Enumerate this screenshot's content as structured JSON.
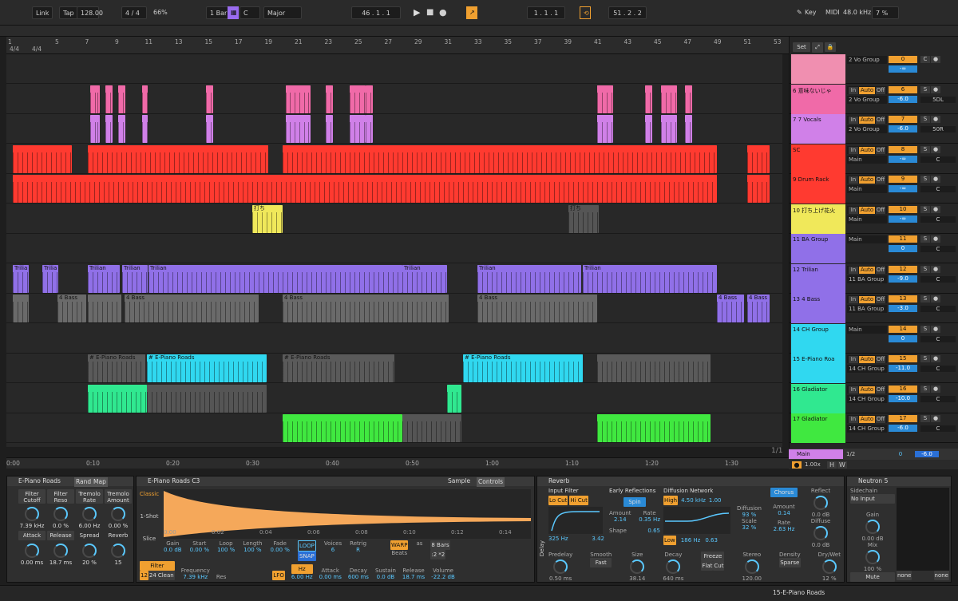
{
  "transport": {
    "link": "Link",
    "tap": "Tap",
    "tempo": "128.00",
    "sig_num": "4",
    "sig_den": "4",
    "groove": "66%",
    "quant": "1 Bar",
    "key": "C",
    "scale": "Major",
    "position": "46 . 1 . 1",
    "loop_start": "1 . 1 . 1",
    "loop_len": "51 . 2 . 2",
    "key_btn": "Key",
    "midi": "MIDI",
    "sample_rate": "48.0 kHz",
    "cpu": "7 %"
  },
  "ruler": {
    "bars": [
      "1",
      "5",
      "7",
      "9",
      "11",
      "13",
      "15",
      "17",
      "19",
      "21",
      "23",
      "25",
      "27",
      "29",
      "31",
      "33",
      "35",
      "37",
      "39",
      "41",
      "43",
      "45",
      "47",
      "49",
      "51",
      "53"
    ],
    "sig": "4/4",
    "sig2": "4/4"
  },
  "timeline": {
    "marks": [
      "0:00",
      "0:10",
      "0:20",
      "0:30",
      "0:40",
      "0:50",
      "1:00",
      "1:10",
      "1:20",
      "1:30"
    ]
  },
  "clips": {
    "trilian": "Trilian",
    "trilia": "Trilia",
    "bass": "4 Bass",
    "epiano": "# E-Piano Roads",
    "uchi": "打ち",
    "uchi2": "打ち"
  },
  "tracks": [
    {
      "name": "",
      "route": "2 Vo Group",
      "vol": "0",
      "pan": "C",
      "vol2": "-∞",
      "color": "#f08fb0"
    },
    {
      "name": "6 意味ないじゃ",
      "route": "2 Vo Group",
      "vol": "6",
      "pan": "S",
      "vol2": "-6.0",
      "pan2": "5DL",
      "color": "#f06aa8",
      "in": "In",
      "auto": "Auto",
      "off": "Off"
    },
    {
      "name": "7 7 Vocals",
      "route": "2 Vo Group",
      "vol": "7",
      "pan": "S",
      "vol2": "-6.0",
      "pan2": "50R",
      "color": "#d080e8",
      "in": "In",
      "auto": "Auto",
      "off": "Off"
    },
    {
      "name": "SC",
      "route": "Main",
      "vol": "8",
      "pan": "S",
      "vol2": "-∞",
      "pan2": "C",
      "color": "#ff3a30",
      "in": "In",
      "auto": "Auto",
      "off": "Off"
    },
    {
      "name": "9 Drum Rack",
      "route": "Main",
      "vol": "9",
      "pan": "S",
      "vol2": "-∞",
      "pan2": "C",
      "color": "#ff3a30",
      "in": "In",
      "auto": "Auto",
      "off": "Off"
    },
    {
      "name": "10 打ち上げ花火",
      "route": "Main",
      "vol": "10",
      "pan": "S",
      "vol2": "-∞",
      "pan2": "C",
      "color": "#f0e85a",
      "in": "In",
      "auto": "Auto",
      "off": "Off"
    },
    {
      "name": "11 BA Group",
      "route": "Main",
      "vol": "11",
      "pan": "S",
      "vol2": "0",
      "pan2": "C",
      "color": "#9070e8"
    },
    {
      "name": "12 Trilian",
      "route": "11 BA Group",
      "vol": "12",
      "pan": "S",
      "vol2": "-9.0",
      "pan2": "C",
      "color": "#9070e8",
      "in": "In",
      "auto": "Auto",
      "off": "Off"
    },
    {
      "name": "13 4 Bass",
      "route": "11 BA Group",
      "vol": "13",
      "pan": "S",
      "vol2": "-3.0",
      "pan2": "C",
      "color": "#9070e8",
      "in": "In",
      "auto": "Auto",
      "off": "Off"
    },
    {
      "name": "14 CH Group",
      "route": "Main",
      "vol": "14",
      "pan": "S",
      "vol2": "0",
      "pan2": "C",
      "color": "#30d8f0"
    },
    {
      "name": "15 E-Piano Roa",
      "route": "14 CH Group",
      "vol": "15",
      "pan": "S",
      "vol2": "-11.0",
      "pan2": "C",
      "color": "#30d8f0",
      "in": "In",
      "auto": "Auto",
      "off": "Off"
    },
    {
      "name": "16 Gladiator",
      "route": "14 CH Group",
      "vol": "16",
      "pan": "S",
      "vol2": "-10.0",
      "pan2": "C",
      "color": "#30e890",
      "in": "In",
      "auto": "Auto",
      "off": "Off"
    },
    {
      "name": "17 Gladiator",
      "route": "14 CH Group",
      "vol": "17",
      "pan": "S",
      "vol2": "-6.0",
      "pan2": "C",
      "color": "#40e840",
      "in": "In",
      "auto": "Auto",
      "off": "Off"
    }
  ],
  "main": {
    "name": "Main",
    "val": "1/2",
    "vol": "0",
    "pan": "-6.0",
    "zoom": "1.00x",
    "h": "H",
    "w": "W",
    "set": "Set",
    "page": "1/1"
  },
  "devices": {
    "rack": {
      "title": "E-Piano Roads",
      "rand": "Rand",
      "map": "Map",
      "k1": "Filter Cutoff",
      "k2": "Filter Reso",
      "k3": "Tremolo Rate",
      "k4": "Tremolo Amount",
      "v1": "7.39 kHz",
      "v2": "0.0 %",
      "v3": "6.00 Hz",
      "v4": "0.00 %",
      "k5": "Attack",
      "k6": "Release",
      "k7": "Spread",
      "k8": "Reverb",
      "v5": "0.00 ms",
      "v6": "18.7 ms",
      "v7": "20 %",
      "v8": "15"
    },
    "simpler": {
      "title": "E-Piano Roads C3",
      "sample": "Sample",
      "controls": "Controls",
      "classic": "Classic",
      "oneshot": "1-Shot",
      "slice": "Slice",
      "gain": "Gain",
      "gain_v": "0.0 dB",
      "start": "Start",
      "start_v": "0.00 %",
      "loop": "Loop",
      "loop_v": "100 %",
      "length": "Length",
      "length_v": "100 %",
      "fade": "Fade",
      "fade_v": "0.00 %",
      "loopbtn": "LOOP",
      "snap": "SNAP",
      "voices": "Voices",
      "voices_v": "6",
      "retrig": "Retrig",
      "retrig_v": "R",
      "warp": "WARP",
      "as": "as",
      "bars": "8 Bars",
      "beats": "Beats",
      "t0": "0:00",
      "t1": "0:02",
      "t2": "0:04",
      "t3": "0:06",
      "t4": "0:08",
      "t5": "0:10",
      "t6": "0:12",
      "t7": "0:14",
      "filter": "Filter",
      "freq": "Frequency",
      "freq_v": "7.39 kHz",
      "res": "Res",
      "f12": "12",
      "f24": "24",
      "clean": "Clean",
      "lfo": "LFO",
      "hz": "Hz",
      "lfo_v": "6.00 Hz",
      "attack": "Attack",
      "attack_v": "0.00 ms",
      "decay": "Decay",
      "decay_v": "600 ms",
      "sustain": "Sustain",
      "sustain_v": "0.0 dB",
      "release": "Release",
      "release_v": "18.7 ms",
      "volume": "Volume",
      "volume_v": "-22.2 dB",
      "ratio1": ":2",
      "ratio2": "*2"
    },
    "reverb": {
      "title": "Reverb",
      "input": "Input Filter",
      "locut": "Lo Cut",
      "hicut": "Hi Cut",
      "in_lo": "325 Hz",
      "in_q": "3.42",
      "early": "Early Reflections",
      "spin": "Spin",
      "amount": "Amount",
      "amount_v": "2.14",
      "rate": "Rate",
      "rate_v": "0.35 Hz",
      "shape": "Shape",
      "shape_v": "0.65",
      "diffnet": "Diffusion Network",
      "high": "High",
      "high_v": "4.50 kHz",
      "high_q": "1.00",
      "low": "Low",
      "low_v": "186 Hz",
      "low_q": "0.63",
      "diffusion": "Diffusion",
      "diffusion_v": "93 %",
      "scale": "Scale",
      "scale_v": "32 %",
      "chorus": "Chorus",
      "ch_amount": "Amount",
      "ch_amount_v": "0.14",
      "ch_rate": "Rate",
      "ch_rate_v": "2.63 Hz",
      "reflect": "Reflect",
      "reflect_v": "0.0 dB",
      "diffuse": "Diffuse",
      "diffuse_v": "0.0 dB",
      "predelay": "Predelay",
      "predelay_v": "0.50 ms",
      "smooth": "Smooth",
      "smooth_v": "Fast",
      "size": "Size",
      "size_v": "38.14",
      "decay": "Decay",
      "decay_v": "640 ms",
      "freeze": "Freeze",
      "flat": "Flat",
      "cut": "Cut",
      "stereo": "Stereo",
      "stereo_v": "120.00",
      "density": "Density",
      "density_v": "Sparse",
      "drywet": "Dry/Wet",
      "drywet_v": "12 %",
      "delay": "Delay"
    },
    "neutron": {
      "title": "Neutron 5",
      "sidechain": "Sidechain",
      "noinput": "No Input",
      "gain": "Gain",
      "gain_v": "0.00 dB",
      "mix": "Mix",
      "mix_v": "100 %",
      "mute": "Mute",
      "none1": "none",
      "none2": "none"
    }
  },
  "status": {
    "track": "15-E-Piano Roads"
  }
}
